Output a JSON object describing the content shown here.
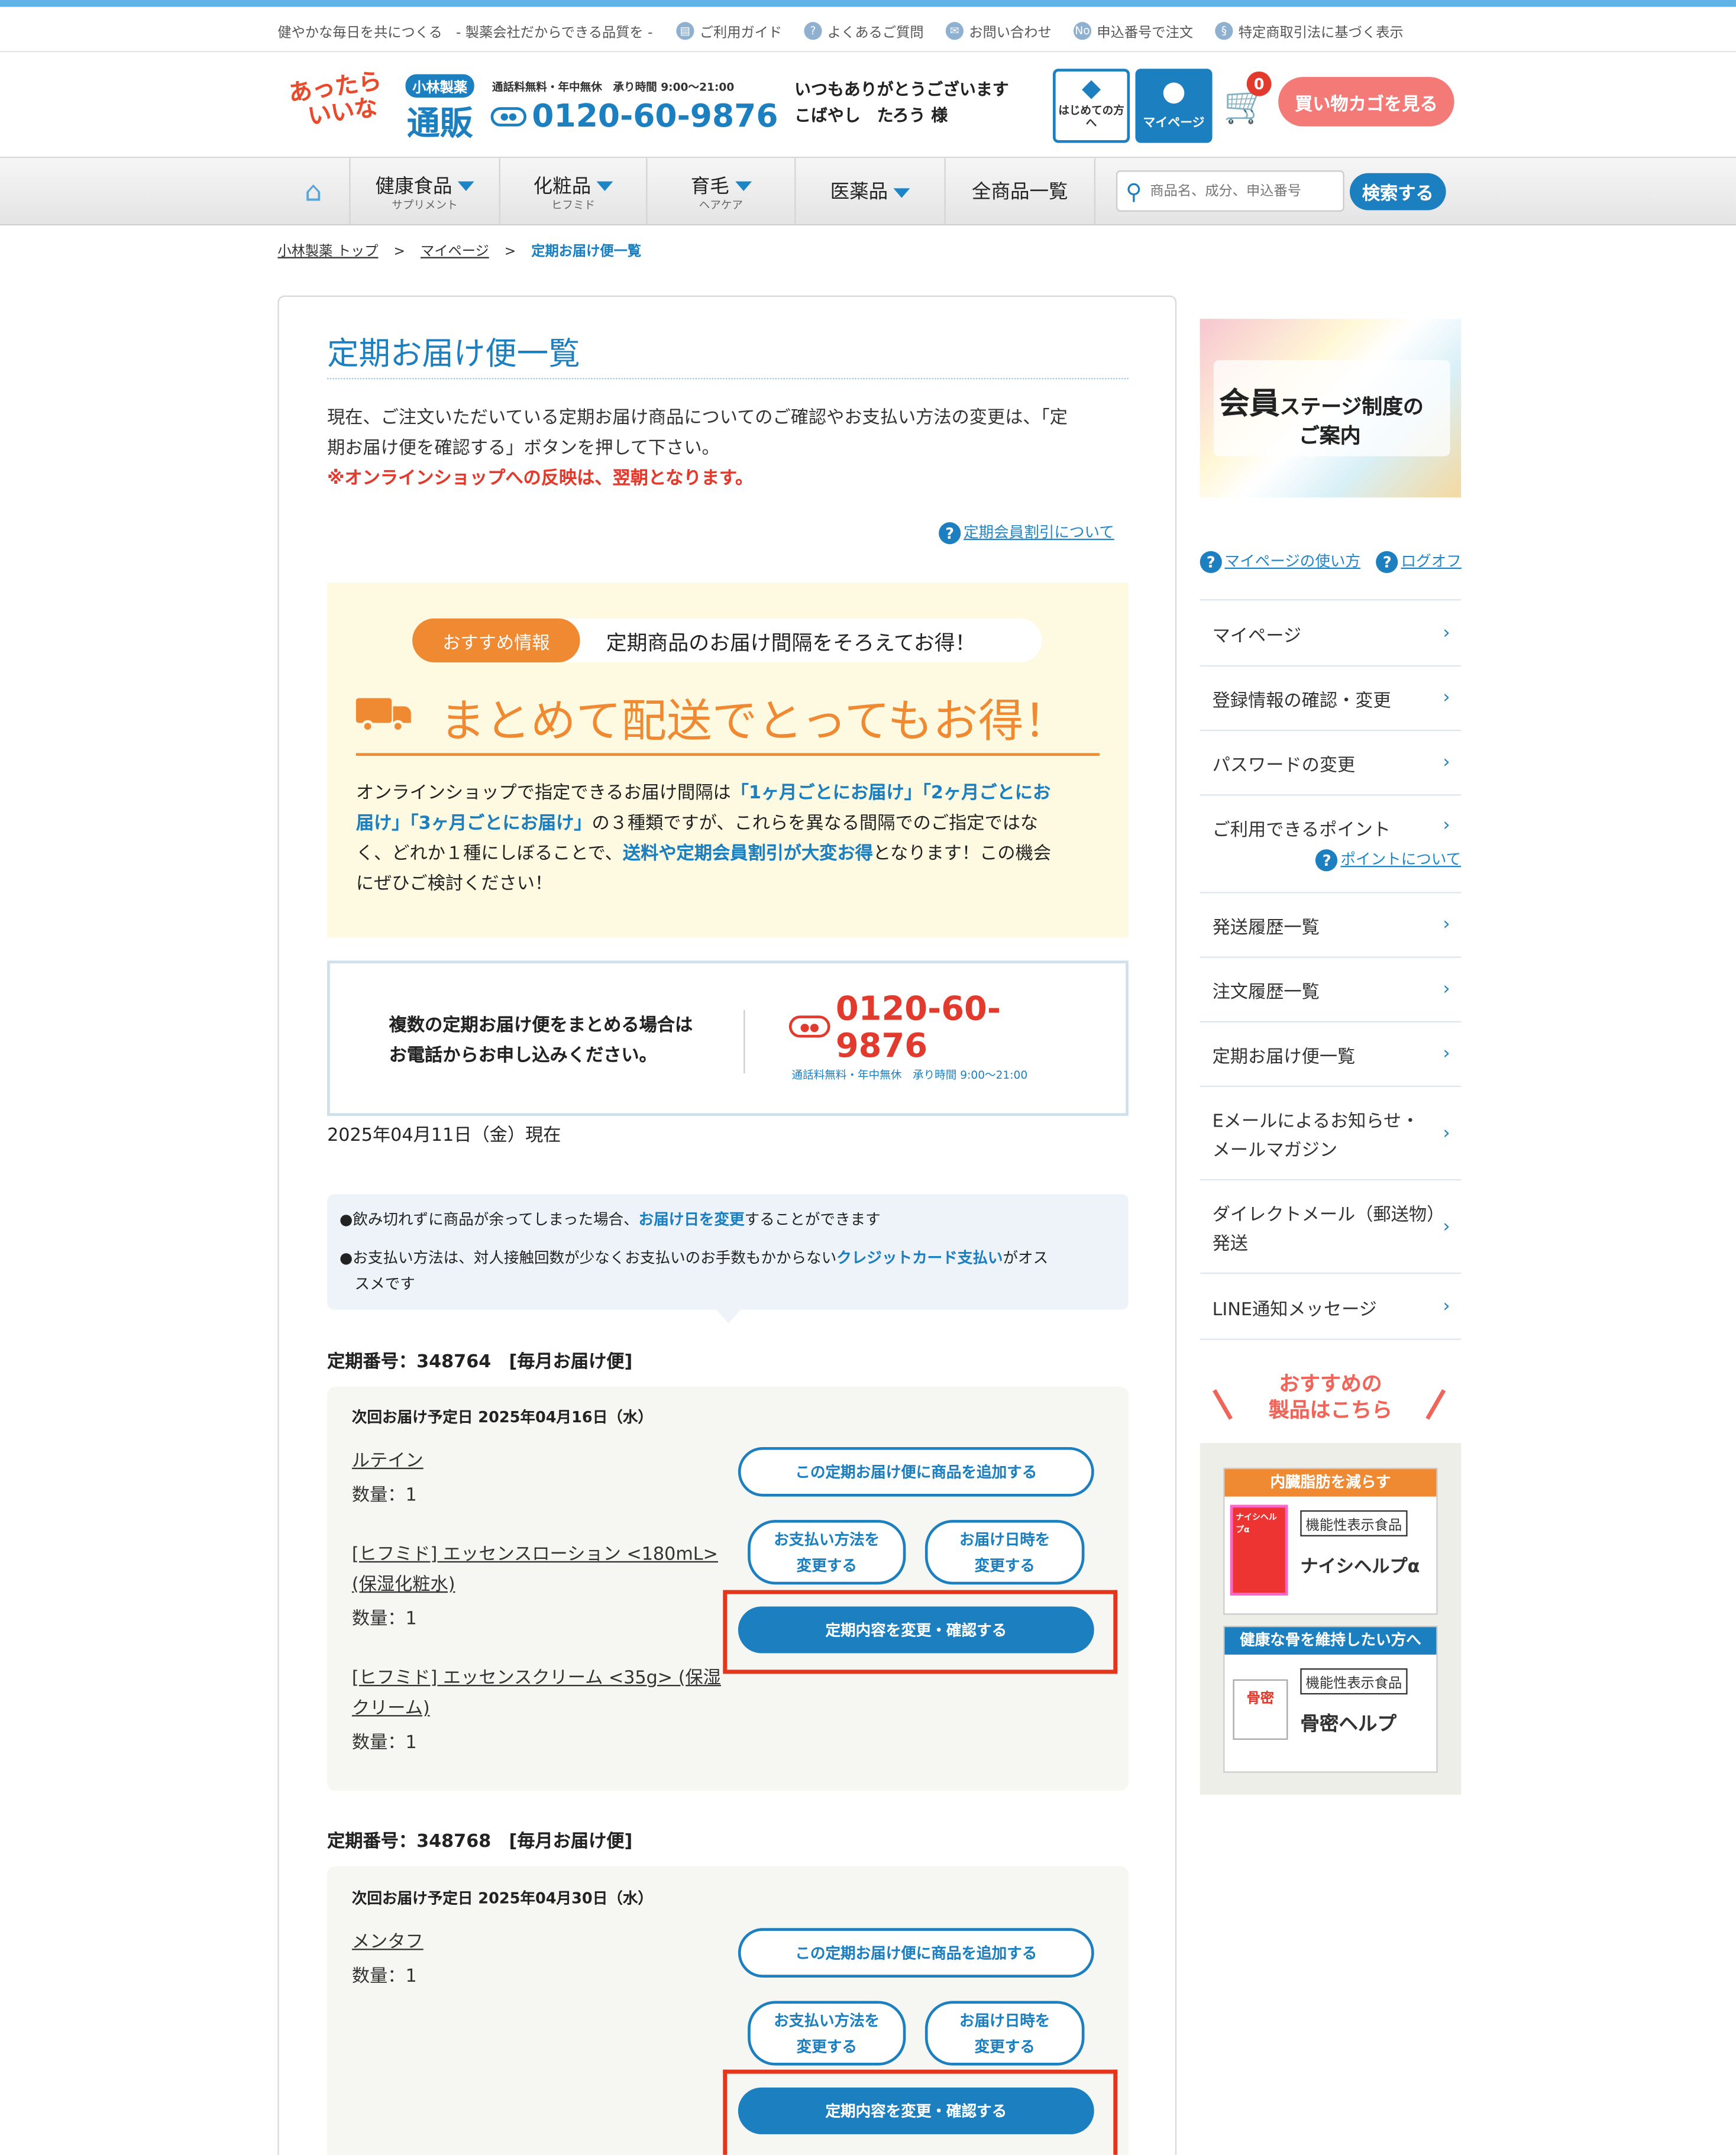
{
  "utility": {
    "tagline": "健やかな毎日を共につくる　- 製薬会社だからできる品質を -",
    "links": [
      "ご利用ガイド",
      "よくあるご質問",
      "お問い合わせ",
      "申込番号で注文",
      "特定商取引法に基づく表示"
    ]
  },
  "header": {
    "logo_line1": "あったら",
    "logo_line2": "いいな",
    "logo_badge": "小林製薬",
    "logo_main": "通販",
    "phone_note": "通話料無料・年中無休　承り時間 9:00〜21:00",
    "phone": "0120-60-9876",
    "greeting": "いつもありがとうございます",
    "user": "こばやし　たろう 様",
    "first_time": "はじめての方へ",
    "mypage": "マイページ",
    "cart_count": "0",
    "cart_button": "買い物カゴを見る"
  },
  "nav": {
    "items": [
      {
        "label": "健康食品",
        "sub": "サプリメント"
      },
      {
        "label": "化粧品",
        "sub": "ヒフミド"
      },
      {
        "label": "育毛",
        "sub": "ヘアケア"
      },
      {
        "label": "医薬品",
        "sub": ""
      },
      {
        "label": "全商品一覧",
        "sub": ""
      }
    ],
    "search_placeholder": "商品名、成分、申込番号",
    "search_button": "検索する"
  },
  "breadcrumb": [
    "小林製薬 トップ",
    "マイページ",
    "定期お届け便一覧"
  ],
  "main": {
    "title": "定期お届け便一覧",
    "intro_line1": "現在、ご注文いただいている定期お届け商品についてのご確認やお支払い方法の変更は、「定",
    "intro_line2": "期お届け便を確認する」ボタンを押して下さい。",
    "notice": "※オンラインショップへの反映は、翌朝となります。",
    "discount_link": "定期会員割引について",
    "promo": {
      "badge": "おすすめ情報",
      "subtitle": "定期商品のお届け間隔をそろえてお得！",
      "headline": "まとめて配送でとってもお得！",
      "l1a": "オンラインショップで指定できるお届け間隔は",
      "l1b": "「1ヶ月ごとにお届け」「2ヶ月ごとにお",
      "l2a": "届け」「3ヶ月ごとにお届け」",
      "l2b": "の３種類ですが、これらを異なる間隔でのご指定ではな",
      "l3a": "く、どれか１種にしぼることで、",
      "l3b": "送料や定期会員割引が大変お得",
      "l3c": "となります！この機会",
      "l4": "にぜひご検討ください！"
    },
    "phonebox": {
      "line1": "複数の定期お届け便をまとめる場合は",
      "line2": "お電話からお申し込みください。",
      "phone_a": "0120-60-",
      "phone_b": "9876",
      "note": "通話料無料・年中無休　承り時間 9:00〜21:00"
    },
    "date": "2025年04月11日（金）現在",
    "tips": {
      "t1a": "●飲み切れずに商品が余ってしまった場合、",
      "t1b": "お届け日を変更",
      "t1c": "することができます",
      "t2a": "●お支払い方法は、対人接触回数が少なくお支払いのお手数もかからない",
      "t2b": "クレジットカード支払い",
      "t2c": "がオス",
      "t2d": "スメです"
    },
    "subscriptions": [
      {
        "header": "定期番号：348764　[毎月お届け便]",
        "next": "次回お届け予定日 2025年04月16日（水）",
        "items": [
          {
            "name_l1": "ルテイン",
            "name_l2": "",
            "qty": "数量：1"
          },
          {
            "name_l1": "[ヒフミド] エッセンスローション <180mL>",
            "name_l2": "(保湿化粧水)",
            "qty": "数量：1"
          },
          {
            "name_l1": "[ヒフミド] エッセンスクリーム <35g> (保湿",
            "name_l2": "クリーム)",
            "qty": "数量：1"
          }
        ],
        "add_button": "この定期お届け便に商品を追加する",
        "pay_l1": "お支払い方法を",
        "pay_l2": "変更する",
        "date_l1": "お届け日時を",
        "date_l2": "変更する",
        "confirm_button": "定期内容を変更・確認する"
      },
      {
        "header": "定期番号：348768　[毎月お届け便]",
        "next": "次回お届け予定日 2025年04月30日（水）",
        "items": [
          {
            "name_l1": "メンタフ",
            "name_l2": "",
            "qty": "数量：1"
          }
        ],
        "add_button": "この定期お届け便に商品を追加する",
        "pay_l1": "お支払い方法を",
        "pay_l2": "変更する",
        "date_l1": "お届け日時を",
        "date_l2": "変更する",
        "confirm_button": "定期内容を変更・確認する"
      }
    ]
  },
  "sidebar": {
    "banner_l1a": "会員",
    "banner_l1b": "ステージ制度の",
    "banner_l2": "ご案内",
    "help_link": "マイページの使い方",
    "logout": "ログオフ",
    "menu": [
      {
        "label": "マイページ"
      },
      {
        "label": "登録情報の確認・変更"
      },
      {
        "label": "パスワードの変更"
      },
      {
        "label": "ご利用できるポイント",
        "sublink": "ポイントについて"
      },
      {
        "label": "発送履歴一覧"
      },
      {
        "label": "注文履歴一覧"
      },
      {
        "label": "定期お届け便一覧"
      },
      {
        "label": "Eメールによるお知らせ・",
        "label2": "メールマガジン"
      },
      {
        "label": "ダイレクトメール（郵送物）",
        "label2": "発送"
      },
      {
        "label": "LINE通知メッセージ"
      }
    ],
    "recommend_l1": "おすすめの",
    "recommend_l2": "製品はこちら",
    "products": [
      {
        "tag": "内臓脂肪を減らす",
        "category": "機能性表示食品",
        "name": "ナイシヘルプα",
        "pkg": "ナイシヘルプα"
      },
      {
        "tag": "健康な骨を維持したい方へ",
        "category": "機能性表示食品",
        "name": "骨密ヘルプ",
        "pkg": "骨密"
      }
    ]
  },
  "colors": {
    "brand_blue": "#1b7fc0",
    "accent_orange": "#f08a32",
    "alert_red": "#e23b2e",
    "promo_bg": "#fef9e1"
  }
}
